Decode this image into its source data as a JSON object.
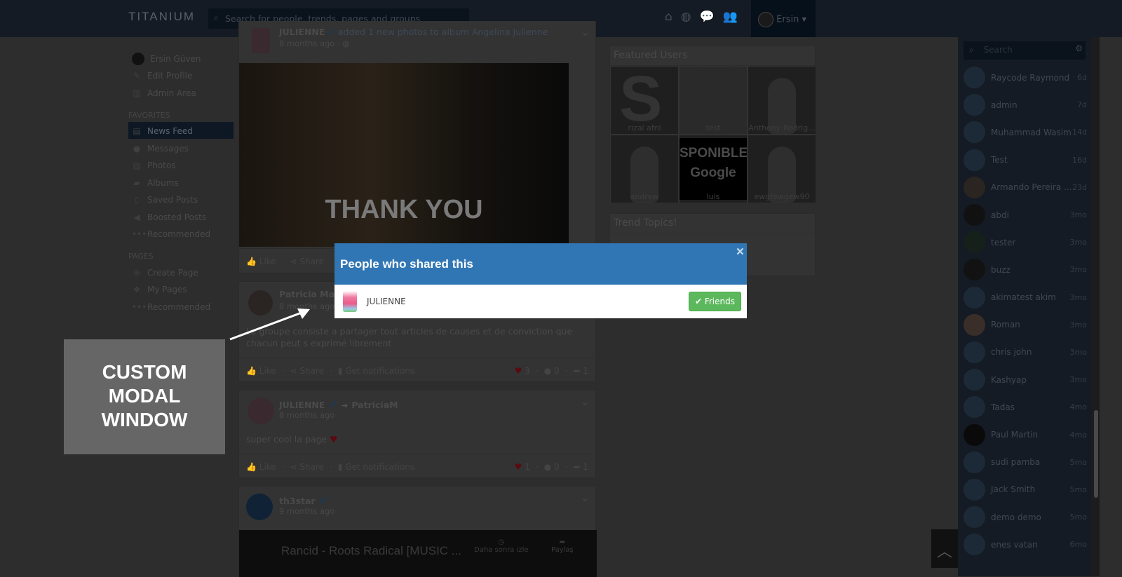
{
  "header": {
    "logo": "TITANIUM",
    "search_placeholder": "Search for people, trends, pages and groups",
    "user_name": "Ersin",
    "nav_icons": [
      "home-icon",
      "globe-icon",
      "comments-icon",
      "users-icon"
    ]
  },
  "sidebar": {
    "profile": [
      {
        "label": "Ersin Güven",
        "icon": "avatar"
      },
      {
        "label": "Edit Profile",
        "icon": "edit-icon"
      },
      {
        "label": "Admin Area",
        "icon": "chart-icon"
      }
    ],
    "favorites_title": "FAVORITES",
    "favorites": [
      {
        "label": "News Feed",
        "icon": "newspaper-icon",
        "active": true
      },
      {
        "label": "Messages",
        "icon": "comments-icon"
      },
      {
        "label": "Photos",
        "icon": "image-icon"
      },
      {
        "label": "Albums",
        "icon": "folder-icon"
      },
      {
        "label": "Saved Posts",
        "icon": "file-icon"
      },
      {
        "label": "Boosted Posts",
        "icon": "bullhorn-icon"
      },
      {
        "label": "Recommended",
        "icon": "ellipsis-icon"
      }
    ],
    "pages_title": "PAGES",
    "pages": [
      {
        "label": "Create Page",
        "icon": "plus-circle-icon"
      },
      {
        "label": "My Pages",
        "icon": "cubes-icon"
      },
      {
        "label": "Recommended",
        "icon": "ellipsis-icon"
      }
    ]
  },
  "feed": {
    "post1": {
      "author": "JULIENNE",
      "activity": "added 1 new photos to album Angelina Julienne",
      "time": "8 months ago",
      "image_text": "THANK YOU",
      "like": "Like",
      "share": "Share"
    },
    "post2": {
      "author": "Patricia Mau",
      "time": "8 months ago",
      "text": "Le groupe consiste a partager tout articles de causes et de conviction que chacun peut s exprimé librement",
      "like": "Like",
      "share": "Share",
      "notify": "Get notifications",
      "reactions": "3",
      "comments": "0",
      "shares": "1"
    },
    "post3": {
      "author": "JULIENNE",
      "target": "PatriciaM",
      "time": "8 months ago",
      "text": "super cool la page",
      "like": "Like",
      "share": "Share",
      "notify": "Get notifications",
      "reactions": "1",
      "comments": "0",
      "shares": "1"
    },
    "post4": {
      "author": "th3star",
      "time": "9 months ago",
      "video_title": "Rancid - Roots Radical [MUSIC ...",
      "watch_later": "Daha sonra izle",
      "share_video": "Paylaş"
    }
  },
  "featured": {
    "title": "Featured Users",
    "users": [
      "rizal afni",
      "test",
      "Anthony Rodrig...",
      "andrew",
      "luis",
      "ewgfewgew90"
    ],
    "tile_text": [
      "S",
      "",
      "",
      "",
      "SPONIBLE Google",
      ""
    ]
  },
  "trends": {
    "title": "Trend Topics!"
  },
  "chat": {
    "search_placeholder": "Search",
    "users": [
      {
        "name": "Raycode Raymond",
        "time": "6d"
      },
      {
        "name": "admin",
        "time": "7d"
      },
      {
        "name": "Muhammad Wasim",
        "time": "14d"
      },
      {
        "name": "Test",
        "time": "16d"
      },
      {
        "name": "Armando Pereira ...",
        "time": "23d"
      },
      {
        "name": "abdi",
        "time": "3mo"
      },
      {
        "name": "tester",
        "time": "3mo"
      },
      {
        "name": "buzz",
        "time": "3mo"
      },
      {
        "name": "akimatest akim",
        "time": "3mo"
      },
      {
        "name": "Roman",
        "time": "3mo"
      },
      {
        "name": "chris john",
        "time": "3mo"
      },
      {
        "name": "Kashyap",
        "time": "3mo"
      },
      {
        "name": "Tadas",
        "time": "4mo"
      },
      {
        "name": "Paul Martin",
        "time": "4mo"
      },
      {
        "name": "sudi pamba",
        "time": "5mo"
      },
      {
        "name": "Jack Smith",
        "time": "5mo"
      },
      {
        "name": "demo demo",
        "time": "5mo"
      },
      {
        "name": "enes vatan",
        "time": "6mo"
      }
    ]
  },
  "modal": {
    "title": "People who shared this",
    "user": "JULIENNE",
    "button": "Friends",
    "close": "×"
  },
  "callout": {
    "text": "CUSTOM MODAL WINDOW"
  },
  "colors": {
    "modal_header": "#3176b4",
    "friends_button": "#5cb85c",
    "callout": "#666666"
  }
}
